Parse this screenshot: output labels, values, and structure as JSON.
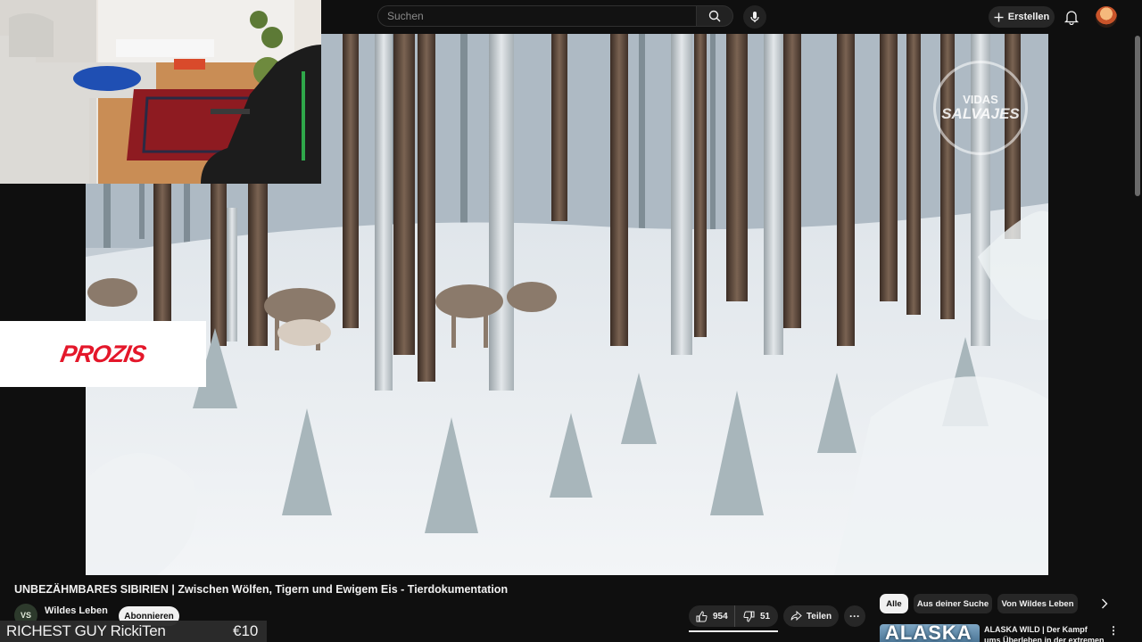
{
  "search": {
    "placeholder": "Suchen"
  },
  "header": {
    "create_label": "Erstellen"
  },
  "video": {
    "watermark_line1": "VIDAS",
    "watermark_line2": "SALVAJES"
  },
  "ad": {
    "brand": "PROZIS"
  },
  "info": {
    "title": "UNBEZÄHMBARES SIBIRIEN | Zwischen Wölfen, Tigern und Ewigem Eis - Tierdokumentation",
    "channel_name": "Wildes Leben",
    "channel_avatar_text": "VS",
    "subscribe_label": "Abonnieren",
    "likes": "954",
    "dislikes": "51",
    "share_label": "Teilen",
    "more_label": "···"
  },
  "chips": [
    {
      "label": "Alle",
      "active": true
    },
    {
      "label": "Aus deiner Suche",
      "active": false
    },
    {
      "label": "Von Wildes Leben",
      "active": false
    }
  ],
  "recommendation": {
    "thumb_text": "ALASKA",
    "title": "ALASKA WILD | Der Kampf ums Überleben in der extremen Käl"
  },
  "donation": {
    "name": "RICHEST GUY RickiTen",
    "amount": "€10"
  },
  "colors": {
    "background": "#0f0f0f",
    "chip": "#272727",
    "accent_red": "#e4172a"
  }
}
